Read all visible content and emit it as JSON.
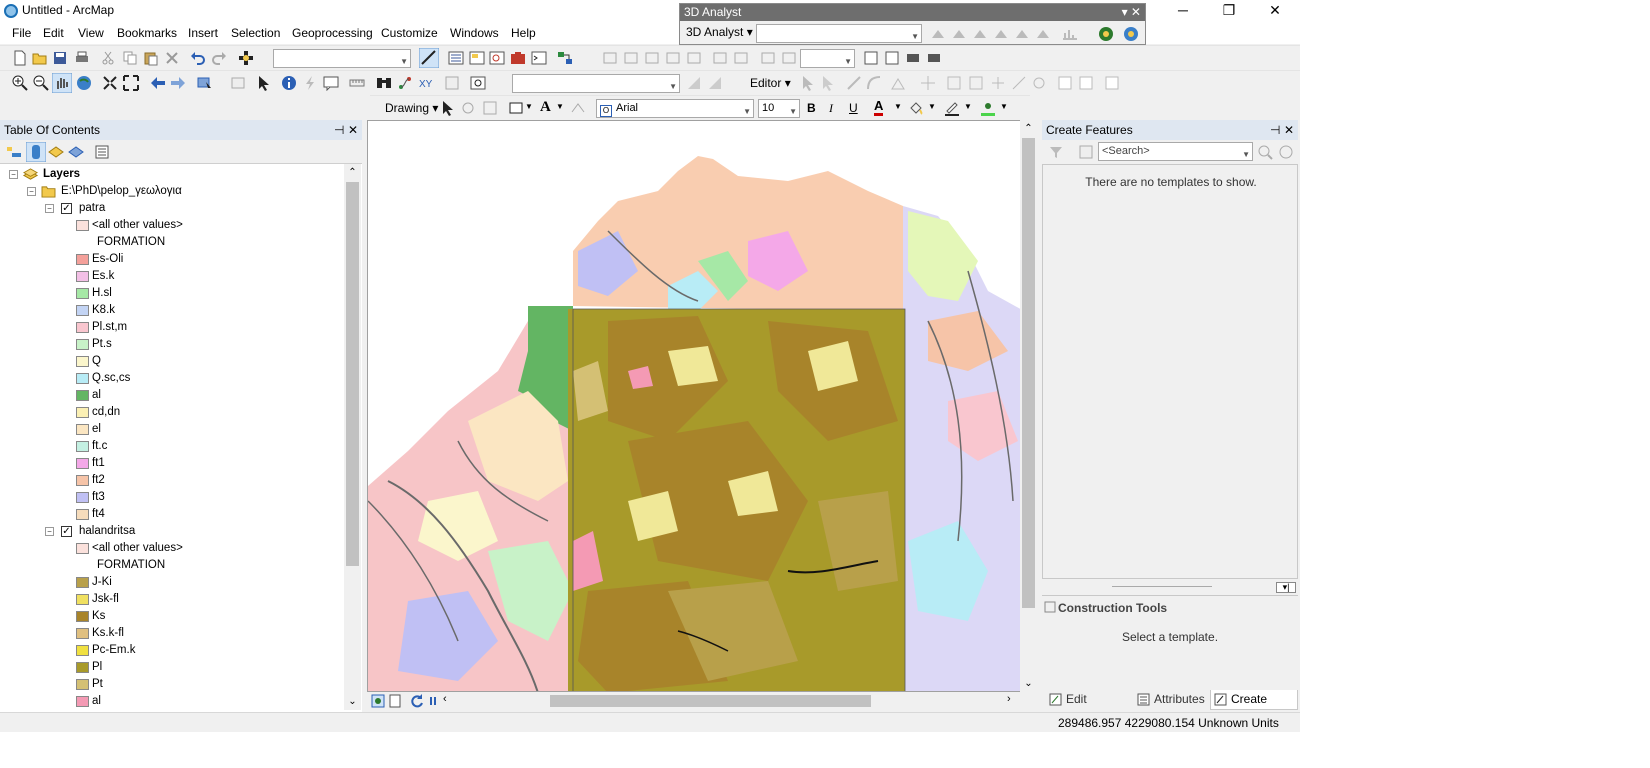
{
  "window": {
    "title": "Untitled - ArcMap",
    "minimize": "─",
    "maximize": "❐",
    "close": "✕"
  },
  "menu": [
    "File",
    "Edit",
    "View",
    "Bookmarks",
    "Insert",
    "Selection",
    "Geoprocessing",
    "Customize",
    "Windows",
    "Help"
  ],
  "toolbar3d": {
    "title": "3D Analyst",
    "dropdown": "3D Analyst",
    "layer_value": ""
  },
  "toolbars": {
    "editor": "Editor",
    "drawing": "Drawing",
    "font": "Arial",
    "font_size": "10",
    "bold": "B",
    "italic": "I",
    "underline": "U",
    "text_tool": "A",
    "font_color": "A"
  },
  "toc": {
    "title": "Table Of Contents",
    "root": "Layers",
    "folder": "E:\\PhD\\pelop_γεωλογια",
    "layers": [
      {
        "name": "patra",
        "checked": true,
        "other": "<all other values>",
        "field": "FORMATION",
        "classes": [
          {
            "label": "Es-Oli",
            "color": "#f4a09a"
          },
          {
            "label": "Es.k",
            "color": "#f3c0e6"
          },
          {
            "label": "H.sl",
            "color": "#a6e8a6"
          },
          {
            "label": "K8.k",
            "color": "#c3d4f4"
          },
          {
            "label": "Pl.st,m",
            "color": "#f9c6cf"
          },
          {
            "label": "Pt.s",
            "color": "#c8f2c8"
          },
          {
            "label": "Q",
            "color": "#fbf6cc"
          },
          {
            "label": "Q.sc,cs",
            "color": "#b8ecf6"
          },
          {
            "label": "al",
            "color": "#63b563"
          },
          {
            "label": "cd,dn",
            "color": "#fbf0b4"
          },
          {
            "label": "el",
            "color": "#fbe6c2"
          },
          {
            "label": "ft.c",
            "color": "#c4f0e2"
          },
          {
            "label": "ft1",
            "color": "#f4a8e8"
          },
          {
            "label": "ft2",
            "color": "#f6c4a8"
          },
          {
            "label": "ft3",
            "color": "#c0c0f4"
          },
          {
            "label": "ft4",
            "color": "#f6dcbc"
          }
        ]
      },
      {
        "name": "halandritsa",
        "checked": true,
        "other": "<all other values>",
        "field": "FORMATION",
        "classes": [
          {
            "label": "J-Ki",
            "color": "#b8a04a"
          },
          {
            "label": "Jsk-fl",
            "color": "#f0e060"
          },
          {
            "label": "Ks",
            "color": "#a8842a"
          },
          {
            "label": "Ks.k-fl",
            "color": "#e0c080"
          },
          {
            "label": "Pc-Em.k",
            "color": "#f0e040"
          },
          {
            "label": "Pl",
            "color": "#a89a2a"
          },
          {
            "label": "Pt",
            "color": "#d4c074"
          },
          {
            "label": "al",
            "color": "#f49ab4"
          }
        ]
      }
    ]
  },
  "create_features": {
    "title": "Create Features",
    "search_placeholder": "<Search>",
    "empty_message": "There are no templates to show.",
    "construction_tools": "Construction Tools",
    "select_template": "Select a template.",
    "tabs": [
      "Edit Sketc...",
      "Attributes",
      "Create Fea..."
    ]
  },
  "status": {
    "coordinates": "289486.957  4229080.154 Unknown Units"
  },
  "icons": [
    "new-icon",
    "open-icon",
    "save-icon",
    "print-icon",
    "cut-icon",
    "copy-icon",
    "paste-icon",
    "delete-icon",
    "undo-icon",
    "redo-icon",
    "add-data-icon",
    "zoom-in-icon",
    "zoom-out-icon",
    "pan-icon",
    "full-extent-icon",
    "identify-icon",
    "find-icon",
    "select-arrow-icon",
    "globe-icon",
    "pin-icon",
    "close-icon"
  ]
}
